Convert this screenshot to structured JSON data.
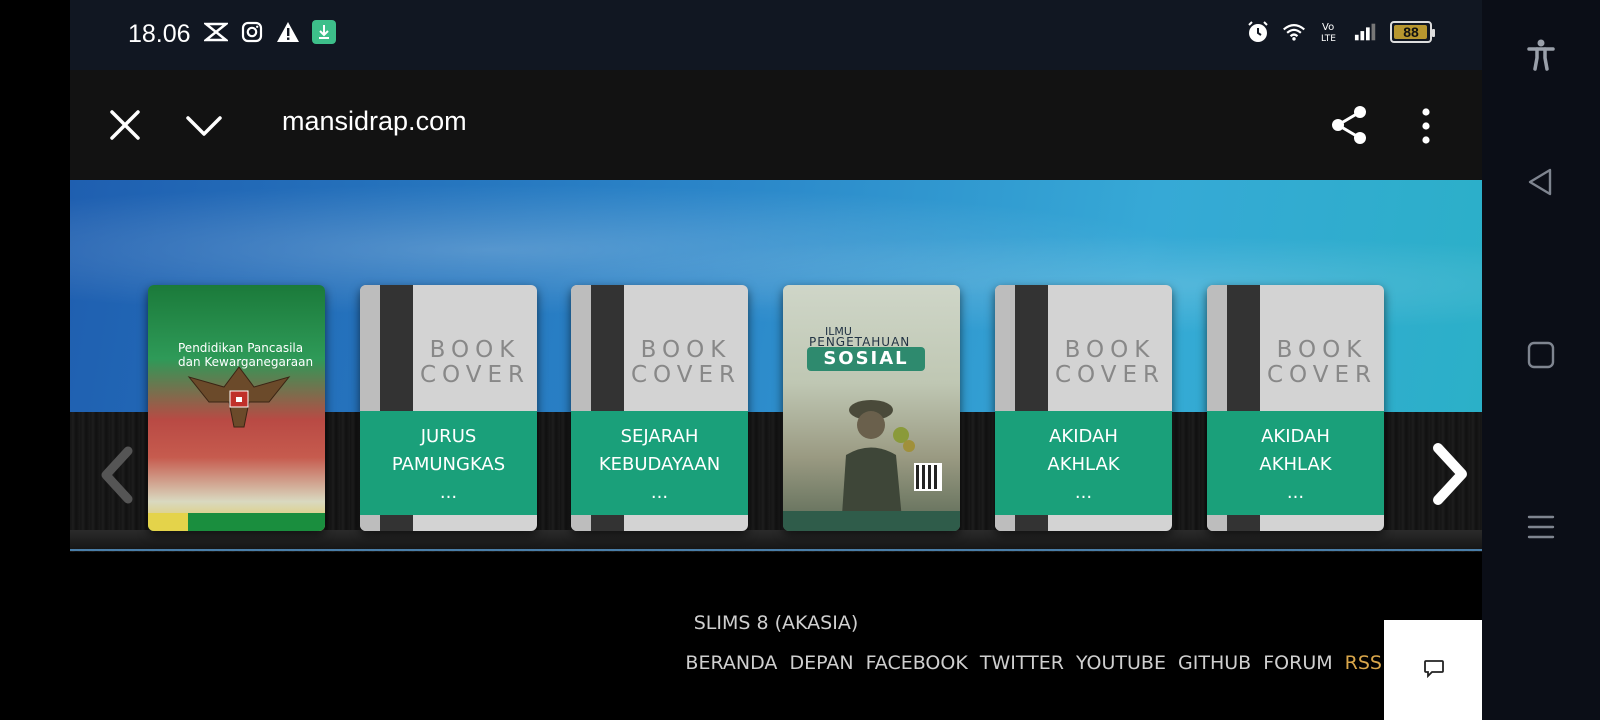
{
  "status_bar": {
    "time": "18.06",
    "battery": "88",
    "left_icons": [
      "capcut-icon",
      "instagram-icon",
      "warning-icon",
      "download-icon"
    ],
    "right_icons": [
      "alarm-icon",
      "wifi-icon",
      "volte-icon",
      "signal-icon"
    ]
  },
  "browser": {
    "url": "mansidrap.com"
  },
  "books": [
    {
      "type": "photo",
      "title_snippet": "Pendidikan Pancasila dan Kewarganegaraan"
    },
    {
      "type": "generic",
      "cover_line1": "BOOK",
      "cover_line2": "COVER",
      "label_line1": "JURUS",
      "label_line2": "PAMUNGKAS",
      "label_line3": "..."
    },
    {
      "type": "generic",
      "cover_line1": "BOOK",
      "cover_line2": "COVER",
      "label_line1": "SEJARAH",
      "label_line2": "KEBUDAYAAN",
      "label_line3": "..."
    },
    {
      "type": "photo",
      "ilmu": "ILMU",
      "pengetahuan": "PENGETAHUAN",
      "sosial": "SOSIAL"
    },
    {
      "type": "generic",
      "cover_line1": "BOOK",
      "cover_line2": "COVER",
      "label_line1": "AKIDAH",
      "label_line2": "AKHLAK",
      "label_line3": "..."
    },
    {
      "type": "generic",
      "cover_line1": "BOOK",
      "cover_line2": "COVER",
      "label_line1": "AKIDAH",
      "label_line2": "AKHLAK",
      "label_line3": "..."
    }
  ],
  "footer": {
    "app_name": "SLIMS 8 (AKASIA)",
    "links": [
      "BERANDA",
      "DEPAN",
      "FACEBOOK",
      "TWITTER",
      "YOUTUBE",
      "GITHUB",
      "FORUM",
      "RSS"
    ]
  },
  "colors": {
    "label_green": "#1aa07a",
    "rss_orange": "#d9a64a",
    "statusbar_bg": "#111722",
    "toolbar_bg": "#121212"
  }
}
